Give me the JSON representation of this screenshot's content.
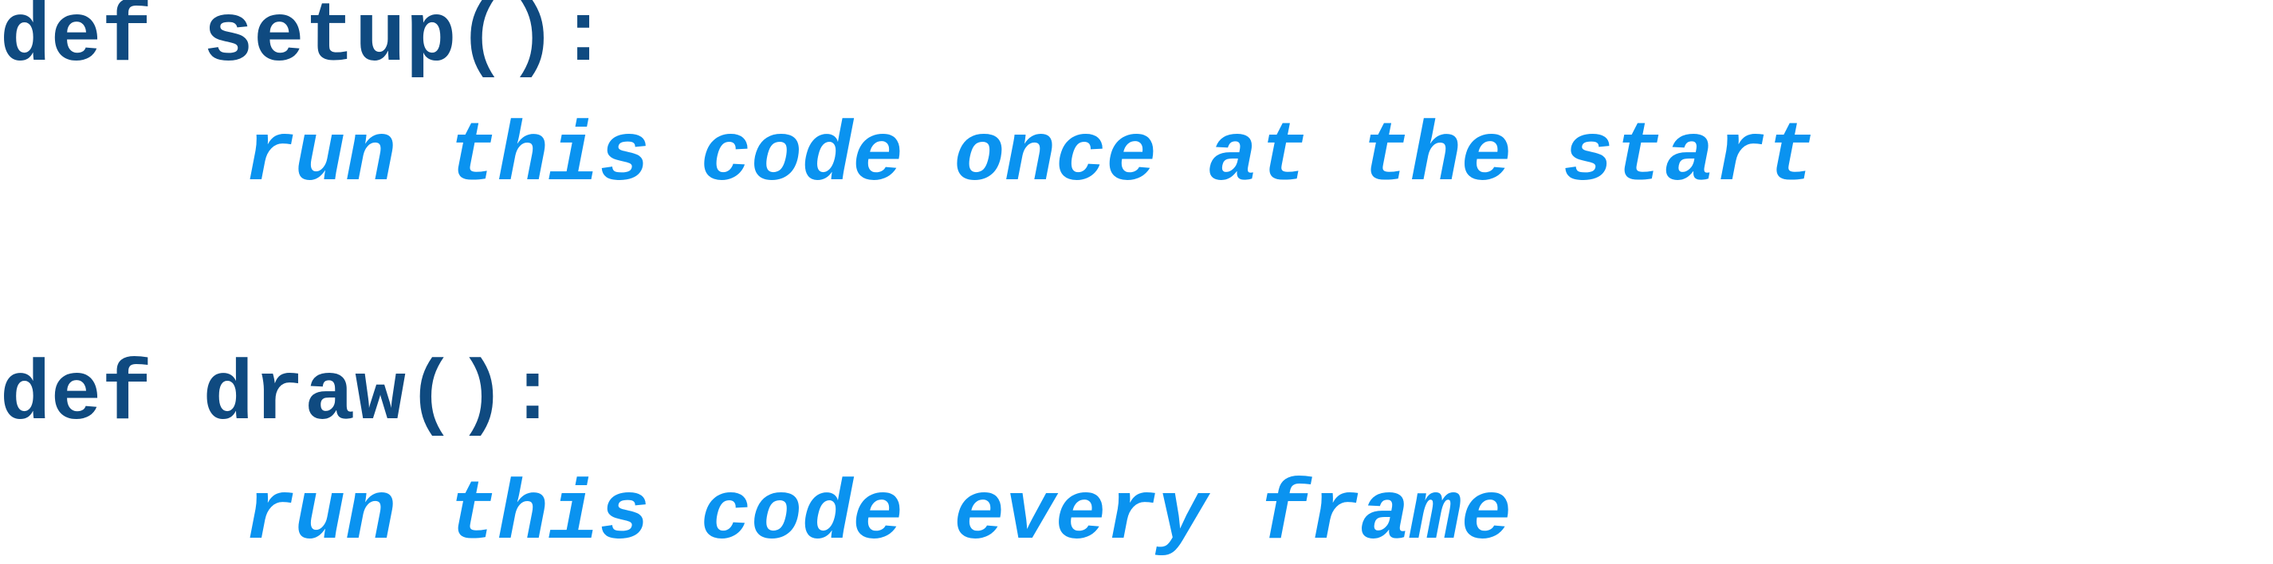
{
  "code": {
    "lines": [
      {
        "text": "def setup():",
        "kind": "keyword"
      },
      {
        "text": "run this code once at the start",
        "kind": "comment"
      },
      {
        "text": "def draw():",
        "kind": "keyword"
      },
      {
        "text": "run this code every frame",
        "kind": "comment"
      }
    ],
    "colors": {
      "keyword": "#0f4a80",
      "comment": "#0a93f0",
      "background": "#ffffff"
    }
  }
}
